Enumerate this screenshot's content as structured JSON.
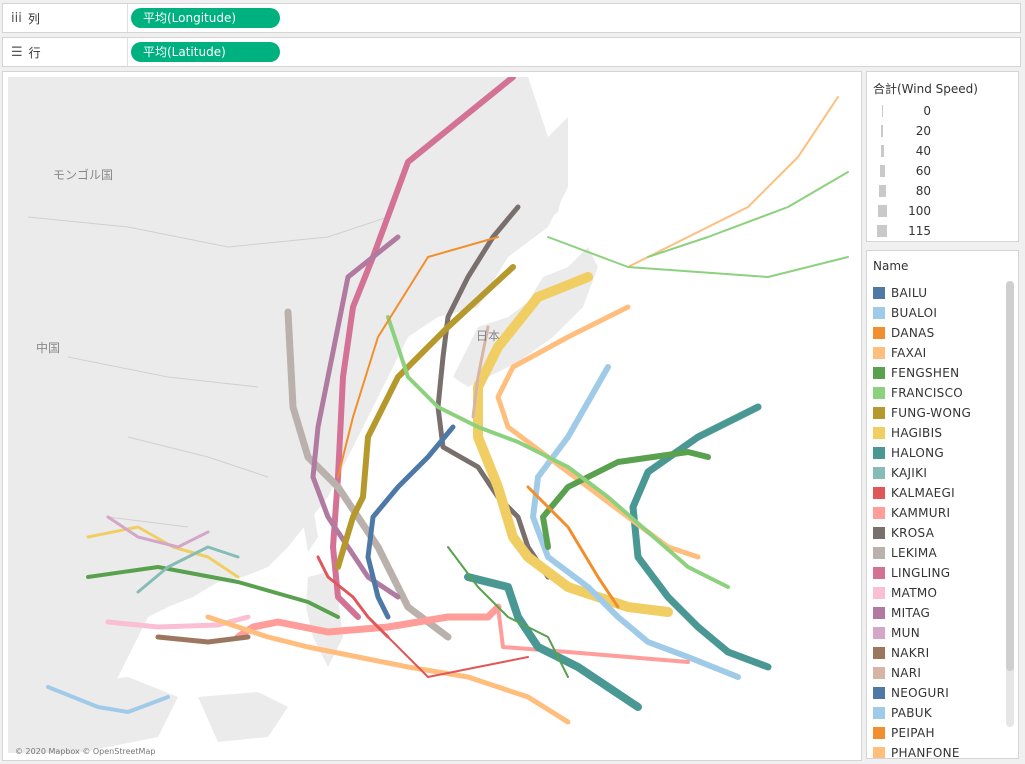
{
  "columns_shelf": {
    "icon": "iii",
    "label": "列",
    "pill": "平均(Longitude)"
  },
  "rows_shelf": {
    "icon": "☰",
    "label": "行",
    "pill": "平均(Latitude)"
  },
  "map": {
    "labels": {
      "mongolia": "モンゴル国",
      "china": "中国",
      "japan": "日本"
    },
    "attribution": "© 2020 Mapbox © OpenStreetMap"
  },
  "size_legend": {
    "title": "合計(Wind Speed)",
    "items": [
      "0",
      "20",
      "40",
      "60",
      "80",
      "100",
      "115"
    ]
  },
  "name_legend": {
    "title": "Name",
    "items": [
      {
        "name": "BAILU",
        "color": "#4e79a7"
      },
      {
        "name": "BUALOI",
        "color": "#a0cbe8"
      },
      {
        "name": "DANAS",
        "color": "#f28e2b"
      },
      {
        "name": "FAXAI",
        "color": "#ffbe7d"
      },
      {
        "name": "FENGSHEN",
        "color": "#59a14f"
      },
      {
        "name": "FRANCISCO",
        "color": "#8cd17d"
      },
      {
        "name": "FUNG-WONG",
        "color": "#b6992d"
      },
      {
        "name": "HAGIBIS",
        "color": "#f1ce63"
      },
      {
        "name": "HALONG",
        "color": "#499894"
      },
      {
        "name": "KAJIKI",
        "color": "#86bcb6"
      },
      {
        "name": "KALMAEGI",
        "color": "#e15759"
      },
      {
        "name": "KAMMURI",
        "color": "#ff9d9a"
      },
      {
        "name": "KROSA",
        "color": "#79706e"
      },
      {
        "name": "LEKIMA",
        "color": "#bab0ac"
      },
      {
        "name": "LINGLING",
        "color": "#d37295"
      },
      {
        "name": "MATMO",
        "color": "#fabfd2"
      },
      {
        "name": "MITAG",
        "color": "#b07aa1"
      },
      {
        "name": "MUN",
        "color": "#d4a6c8"
      },
      {
        "name": "NAKRI",
        "color": "#9d7660"
      },
      {
        "name": "NARI",
        "color": "#d7b5a6"
      },
      {
        "name": "NEOGURI",
        "color": "#4e79a7"
      },
      {
        "name": "PABUK",
        "color": "#a0cbe8"
      },
      {
        "name": "PEIPAH",
        "color": "#f28e2b"
      },
      {
        "name": "PHANFONE",
        "color": "#ffbe7d"
      }
    ]
  }
}
